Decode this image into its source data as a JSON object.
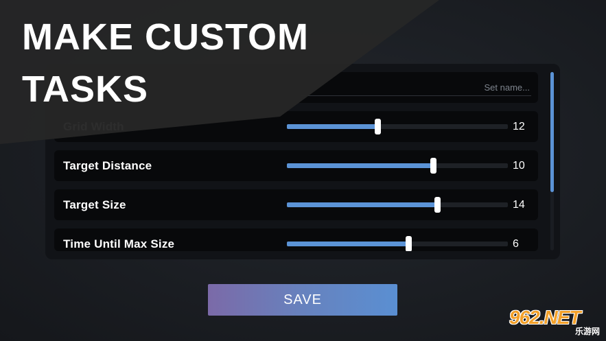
{
  "heading": "MAKE CUSTOM\nTASKS",
  "name_field": {
    "placeholder": "Set name...",
    "value": ""
  },
  "settings": [
    {
      "label": "Grid Width",
      "value": "12",
      "fraction": 0.41
    },
    {
      "label": "Target Distance",
      "value": "10",
      "fraction": 0.66
    },
    {
      "label": "Target Size",
      "value": "14",
      "fraction": 0.68
    },
    {
      "label": "Time Until Max Size",
      "value": "6",
      "fraction": 0.55
    }
  ],
  "save_label": "SAVE",
  "scroll_fraction": 0.0,
  "watermark": {
    "main": "962.NET",
    "sub": "乐游网"
  },
  "colors": {
    "accent": "#5b93d6",
    "save_gradient_start": "#7b6aa8",
    "save_gradient_end": "#5a8fd2",
    "watermark": "#f2a02a"
  }
}
